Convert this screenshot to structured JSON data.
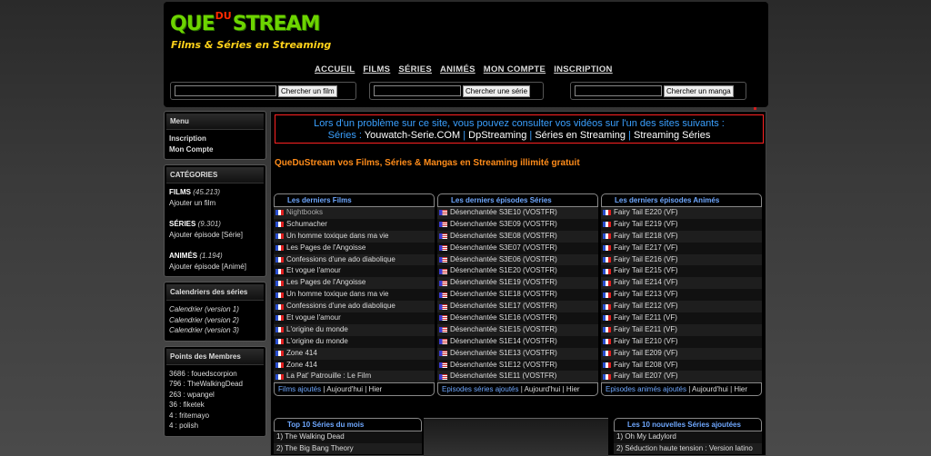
{
  "logo": {
    "que": "QUE",
    "du": "DU",
    "stream": "STREAM",
    "tagline": "Films & Séries en Streaming"
  },
  "nav": [
    "ACCUEIL",
    "FILMS",
    "SÉRIES",
    "ANIMÉS",
    "MON COMPTE",
    "INSCRIPTION"
  ],
  "search": {
    "film_button": "Chercher un film",
    "serie_button": "Chercher une série",
    "manga_button": "Chercher un manga"
  },
  "sidebar": {
    "menu_title": "Menu",
    "inscription": "Inscription",
    "mon_compte": "Mon Compte",
    "categories_title": "CATÉGORIES",
    "films_label": "FILMS",
    "films_count": "(45.213)",
    "films_add": "Ajouter un film",
    "series_label": "SÉRIES",
    "series_count": "(9.301)",
    "series_add": "Ajouter épisode [Série]",
    "animes_label": "ANIMÉS",
    "animes_count": "(1.194)",
    "animes_add": "Ajouter épisode [Animé]",
    "calendars_title": "Calendriers des séries",
    "calendars": [
      "Calendrier (version 1)",
      "Calendrier (version 2)",
      "Calendrier (version 3)"
    ],
    "points_title": "Points des Membres",
    "points": [
      "3686 : fouedscorpion",
      "796 : TheWalkingDead",
      "263 : wpangel",
      "36 : fiketek",
      "4 : fritemayo",
      "4 : polish"
    ]
  },
  "alert": {
    "line1": "Lors d'un problème sur ce site, vous pouvez consulter vos vidéos sur l'un des sites suivants :",
    "series_label": "Séries :",
    "sites": [
      "Youwatch-Serie.COM",
      "DpStreaming",
      "Séries en Streaming",
      "Streaming Séries"
    ],
    "separator": "|"
  },
  "intro": "QueDuStream vos Films, Séries & Mangas en Streaming illimité gratuit",
  "films": {
    "title": "Les derniers Films",
    "items": [
      "Nightbooks",
      "Schumacher",
      "Un homme toxique dans ma vie",
      "Les Pages de l'Angoisse",
      "Confessions d'une ado diabolique",
      "Et vogue l'amour",
      "Les Pages de l'Angoisse",
      "Un homme toxique dans ma vie",
      "Confessions d'une ado diabolique",
      "Et vogue l'amour",
      "L'origine du monde",
      "L'origine du monde",
      "Zone 414",
      "Zone 414",
      "La Pat' Patrouille : Le Film"
    ],
    "footer_link": "Films ajoutés",
    "footer_today": "Aujourd'hui",
    "footer_yesterday": "Hier"
  },
  "series": {
    "title": "Les derniers épisodes Séries",
    "items": [
      "Désenchantée S3E10 (VOSTFR)",
      "Désenchantée S3E09 (VOSTFR)",
      "Désenchantée S3E08 (VOSTFR)",
      "Désenchantée S3E07 (VOSTFR)",
      "Désenchantée S3E06 (VOSTFR)",
      "Désenchantée S1E20 (VOSTFR)",
      "Désenchantée S1E19 (VOSTFR)",
      "Désenchantée S1E18 (VOSTFR)",
      "Désenchantée S1E17 (VOSTFR)",
      "Désenchantée S1E16 (VOSTFR)",
      "Désenchantée S1E15 (VOSTFR)",
      "Désenchantée S1E14 (VOSTFR)",
      "Désenchantée S1E13 (VOSTFR)",
      "Désenchantée S1E12 (VOSTFR)",
      "Désenchantée S1E11 (VOSTFR)"
    ],
    "footer_link": "Episodes séries ajoutés",
    "footer_today": "Aujourd'hui",
    "footer_yesterday": "Hier"
  },
  "animes": {
    "title": "Les derniers épisodes Animés",
    "items": [
      "Fairy Tail E220 (VF)",
      "Fairy Tail E219 (VF)",
      "Fairy Tail E218 (VF)",
      "Fairy Tail E217 (VF)",
      "Fairy Tail E216 (VF)",
      "Fairy Tail E215 (VF)",
      "Fairy Tail E214 (VF)",
      "Fairy Tail E213 (VF)",
      "Fairy Tail E212 (VF)",
      "Fairy Tail E211 (VF)",
      "Fairy Tail E211 (VF)",
      "Fairy Tail E210 (VF)",
      "Fairy Tail E209 (VF)",
      "Fairy Tail E208 (VF)",
      "Fairy Tail E207 (VF)"
    ],
    "footer_link": "Episodes animés ajoutés",
    "footer_today": "Aujourd'hui",
    "footer_yesterday": "Hier"
  },
  "top10": {
    "title": "Top 10 Séries du mois",
    "items": [
      "1) The Walking Dead",
      "2) The Big Bang Theory"
    ]
  },
  "new10": {
    "title": "Les 10 nouvelles Séries ajoutées",
    "items": [
      "1) Oh My Ladylord",
      "2) Séduction haute tension : Version latino"
    ]
  },
  "colors": {
    "logo_green": "#6dd400",
    "logo_red": "#ff2a00",
    "tagline": "#ffd21a",
    "link_blue": "#6fa8ff",
    "intro_orange": "#ff8c1a",
    "alert_border": "#ff2222"
  },
  "icons": {
    "film_flag": "french-flag-icon",
    "series_flag": "us-flag-icon"
  }
}
